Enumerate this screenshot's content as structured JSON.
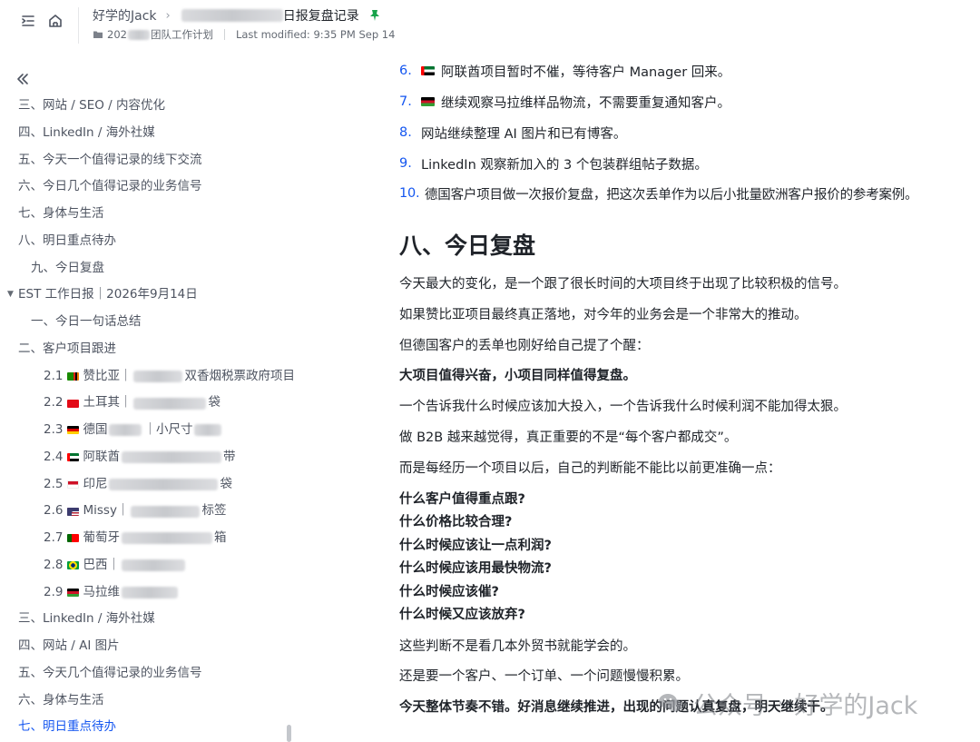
{
  "header": {
    "breadcrumb_parent": "好学的Jack",
    "doc_title_suffix": "日报复盘记录",
    "folder_prefix": "202",
    "folder_suffix": "团队工作计划",
    "last_modified": "Last modified: 9:35 PM Sep 14"
  },
  "sidebar": {
    "items": [
      {
        "label": "三、网站 / SEO / 内容优化"
      },
      {
        "label": "四、LinkedIn / 海外社媒"
      },
      {
        "label": "五、今天一个值得记录的线下交流"
      },
      {
        "label": "六、今日几个值得记录的业务信号"
      },
      {
        "label": "七、身体与生活"
      },
      {
        "label": "八、明日重点待办"
      },
      {
        "label": "九、今日复盘"
      },
      {
        "label": "EST 工作日报｜2026年9月14日"
      },
      {
        "label": "一、今日一句话总结"
      },
      {
        "label": "二、客户项目跟进"
      },
      {
        "label": "2.1",
        "text": "赞比亚｜",
        "tail": "双香烟税票政府项目",
        "flag": "zambia"
      },
      {
        "label": "2.2",
        "text": "土耳其｜",
        "tail": "袋",
        "flag": "turkey"
      },
      {
        "label": "2.3",
        "text": "德国",
        "tail": "｜小尺寸",
        "flag": "germany"
      },
      {
        "label": "2.4",
        "text": "阿联酋",
        "tail": "带",
        "flag": "uae"
      },
      {
        "label": "2.5",
        "text": "印尼",
        "tail": "袋",
        "flag": "indonesia"
      },
      {
        "label": "2.6",
        "text": "Missy｜",
        "tail": "标签",
        "flag": "usa"
      },
      {
        "label": "2.7",
        "text": "葡萄牙",
        "tail": "箱",
        "flag": "portugal"
      },
      {
        "label": "2.8",
        "text": "巴西｜",
        "tail": "",
        "flag": "brazil"
      },
      {
        "label": "2.9",
        "text": "马拉维",
        "tail": "",
        "flag": "malawi"
      },
      {
        "label": "三、LinkedIn / 海外社媒"
      },
      {
        "label": "四、网站 / AI 图片"
      },
      {
        "label": "五、今天几个值得记录的业务信号"
      },
      {
        "label": "六、身体与生活"
      },
      {
        "label": "七、明日重点待办"
      }
    ]
  },
  "main": {
    "list": [
      {
        "num": "6.",
        "text": "阿联酋项目暂时不催，等待客户 Manager 回来。",
        "flag": "uae"
      },
      {
        "num": "7.",
        "text": "继续观察马拉维样品物流，不需要重复通知客户。",
        "flag": "malawi"
      },
      {
        "num": "8.",
        "text": "网站继续整理 AI 图片和已有博客。"
      },
      {
        "num": "9.",
        "text": "LinkedIn 观察新加入的 3 个包装群组帖子数据。"
      },
      {
        "num": "10.",
        "text": "德国客户项目做一次报价复盘，把这次丢单作为以后小批量欧洲客户报价的参考案例。"
      }
    ],
    "heading": "八、今日复盘",
    "paragraphs": [
      "今天最大的变化，是一个跟了很长时间的大项目终于出现了比较积极的信号。",
      "如果赞比亚项目最终真正落地，对今年的业务会是一个非常大的推动。",
      "但德国客户的丢单也刚好给自己提了个醒：",
      "大项目值得兴奋，小项目同样值得复盘。",
      "一个告诉我什么时候应该加大投入，一个告诉我什么时候利润不能加得太狠。",
      "做 B2B 越来越觉得，真正重要的不是“每个客户都成交”。",
      "而是每经历一个项目以后，自己的判断能不能比以前更准确一点："
    ],
    "questions": [
      "什么客户值得重点跟?",
      "什么价格比较合理?",
      "什么时候应该让一点利润?",
      "什么时候应该用最快物流?",
      "什么时候应该催?",
      "什么时候又应该放弃?"
    ],
    "closing": [
      "这些判断不是看几本外贸书就能学会的。",
      "还是要一个客户、一个订单、一个问题慢慢积累。",
      "今天整体节奏不错。好消息继续推进，出现的问题认真复盘，明天继续干。"
    ]
  },
  "watermark": {
    "left": "公众号",
    "right": "好学的Jack"
  },
  "colors": {
    "accent": "#1456f0",
    "text": "#1f2329",
    "muted": "#4e5461",
    "pin": "#17a34a"
  }
}
